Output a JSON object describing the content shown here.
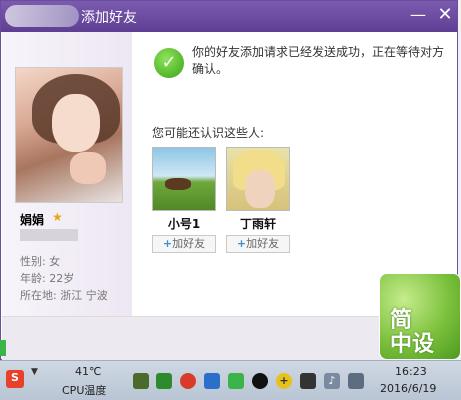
{
  "dialog": {
    "title": "添加好友",
    "minimize_label": "—",
    "close_label": "✕"
  },
  "profile": {
    "name": "娟娟",
    "gender": "性别: 女",
    "age": "年龄: 22岁",
    "location": "所在地: 浙江  宁波"
  },
  "content": {
    "message": "你的好友添加请求已经发送成功，正在等待对方确认。",
    "suggest_title": "您可能还认识这些人:",
    "suggestions": [
      {
        "name": "小号1",
        "add_label": "加好友"
      },
      {
        "name": "丁雨轩",
        "add_label": "加好友"
      }
    ]
  },
  "watermark": {
    "line1": "简",
    "line2": "中设"
  },
  "taskbar": {
    "temperature": "41℃",
    "cpu_label": "CPU温度",
    "time": "16:23",
    "date": "2016/6/19"
  },
  "colors": {
    "titlebar": "#6b4e9a",
    "check": "#3aa316",
    "accent_link": "#3c8fd2"
  },
  "icons": [
    "minimize-icon",
    "close-icon",
    "star-icon",
    "check-icon",
    "plus-icon"
  ]
}
